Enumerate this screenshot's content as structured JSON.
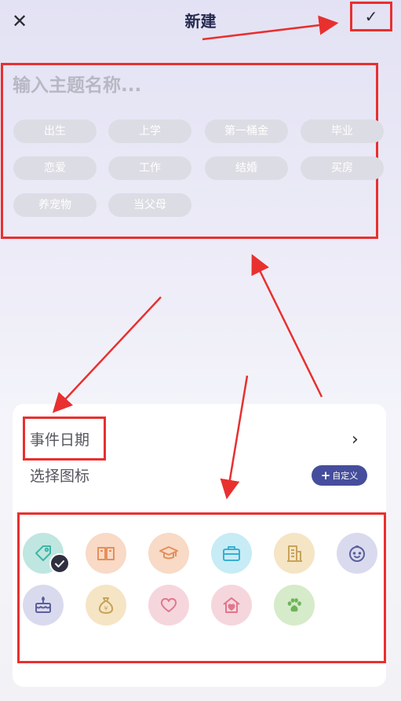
{
  "header": {
    "title": "新建",
    "close_label": "✕",
    "confirm_label": "✓"
  },
  "topic": {
    "placeholder": "输入主题名称...",
    "chips": [
      "出生",
      "上学",
      "第一桶金",
      "毕业",
      "恋爱",
      "工作",
      "结婚",
      "买房",
      "养宠物",
      "当父母"
    ]
  },
  "event": {
    "date_label": "事件日期",
    "select_icon_label": "选择图标",
    "custom_label": "自定义",
    "chevron": "›"
  },
  "icons": [
    {
      "name": "tag-icon",
      "bg": "#bfe6e0",
      "color": "#3fb5a7",
      "selected": true
    },
    {
      "name": "book-icon",
      "bg": "#f8dac6",
      "color": "#e58f5a"
    },
    {
      "name": "graduation-cap-icon",
      "bg": "#f8dac6",
      "color": "#e58f5a"
    },
    {
      "name": "briefcase-icon",
      "bg": "#c7ecf6",
      "color": "#3aaed0"
    },
    {
      "name": "building-icon",
      "bg": "#f5e5c4",
      "color": "#c8a35a"
    },
    {
      "name": "baby-face-icon",
      "bg": "#d9daee",
      "color": "#5b5f9c"
    },
    {
      "name": "birthday-cake-icon",
      "bg": "#d9daee",
      "color": "#5b5f9c"
    },
    {
      "name": "money-bag-icon",
      "bg": "#f5e5c4",
      "color": "#c8a35a"
    },
    {
      "name": "heart-icon",
      "bg": "#f6d6dd",
      "color": "#e1768c"
    },
    {
      "name": "home-heart-icon",
      "bg": "#f6d6dd",
      "color": "#e1768c"
    },
    {
      "name": "paw-icon",
      "bg": "#d5ebc9",
      "color": "#6fb35a"
    }
  ],
  "colors": {
    "annotation_red": "#e8302f",
    "accent": "#454e9c"
  }
}
